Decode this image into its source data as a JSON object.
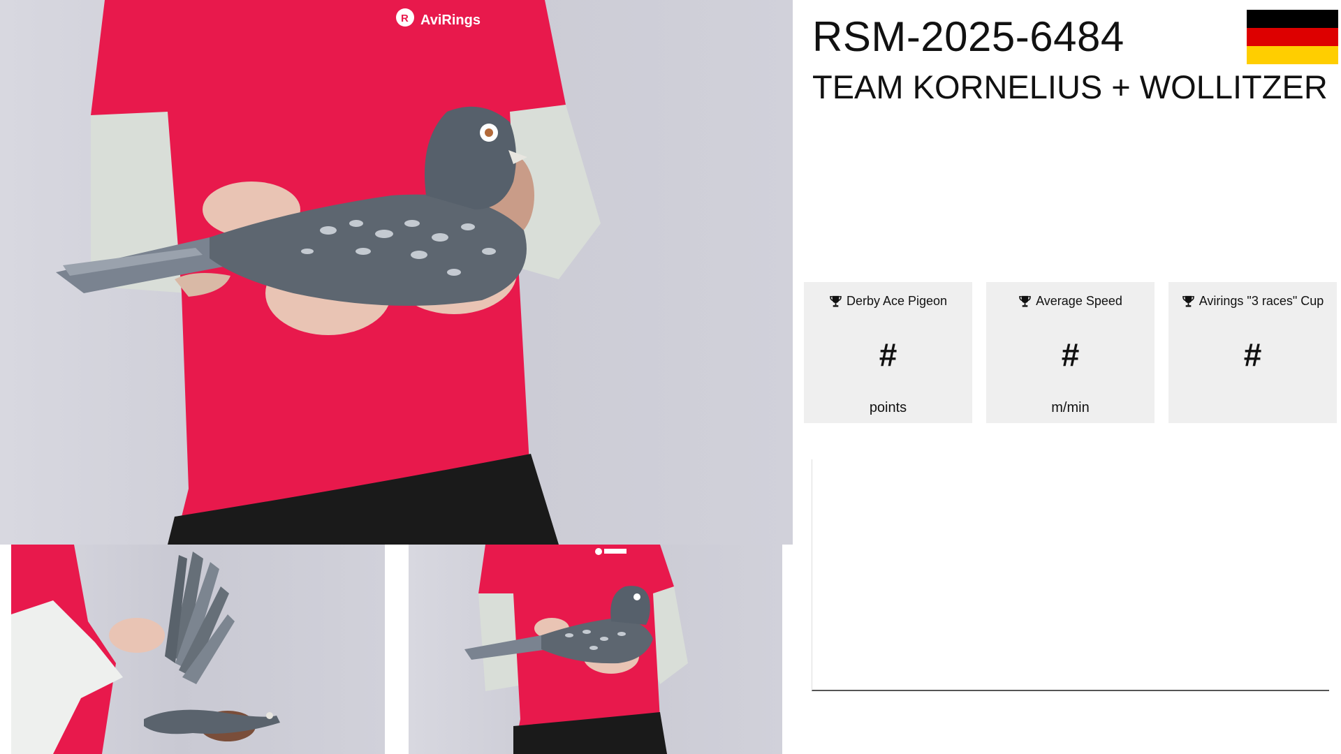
{
  "header": {
    "ring_number": "RSM-2025-6484",
    "owner_name": "TEAM KORNELIUS + WOLLITZER"
  },
  "flag": {
    "country": "Germany",
    "stripes": [
      "#000000",
      "#DD0000",
      "#FFCE00"
    ]
  },
  "stats": [
    {
      "label": "Derby Ace Pigeon",
      "value": "#",
      "unit": "points",
      "icon": "trophy-icon"
    },
    {
      "label": "Average Speed",
      "value": "#",
      "unit": "m/min",
      "icon": "trophy-icon"
    },
    {
      "label": "Avirings \"3 races\" Cup",
      "value": "#",
      "unit": "",
      "icon": "trophy-icon"
    }
  ],
  "photos": {
    "shirt_logo": "AviRings"
  },
  "colors": {
    "shirt_red": "#e8194c",
    "sleeve_grey": "#d9ded8",
    "card_bg": "#efefef",
    "pigeon_blue": "#5d6670"
  }
}
